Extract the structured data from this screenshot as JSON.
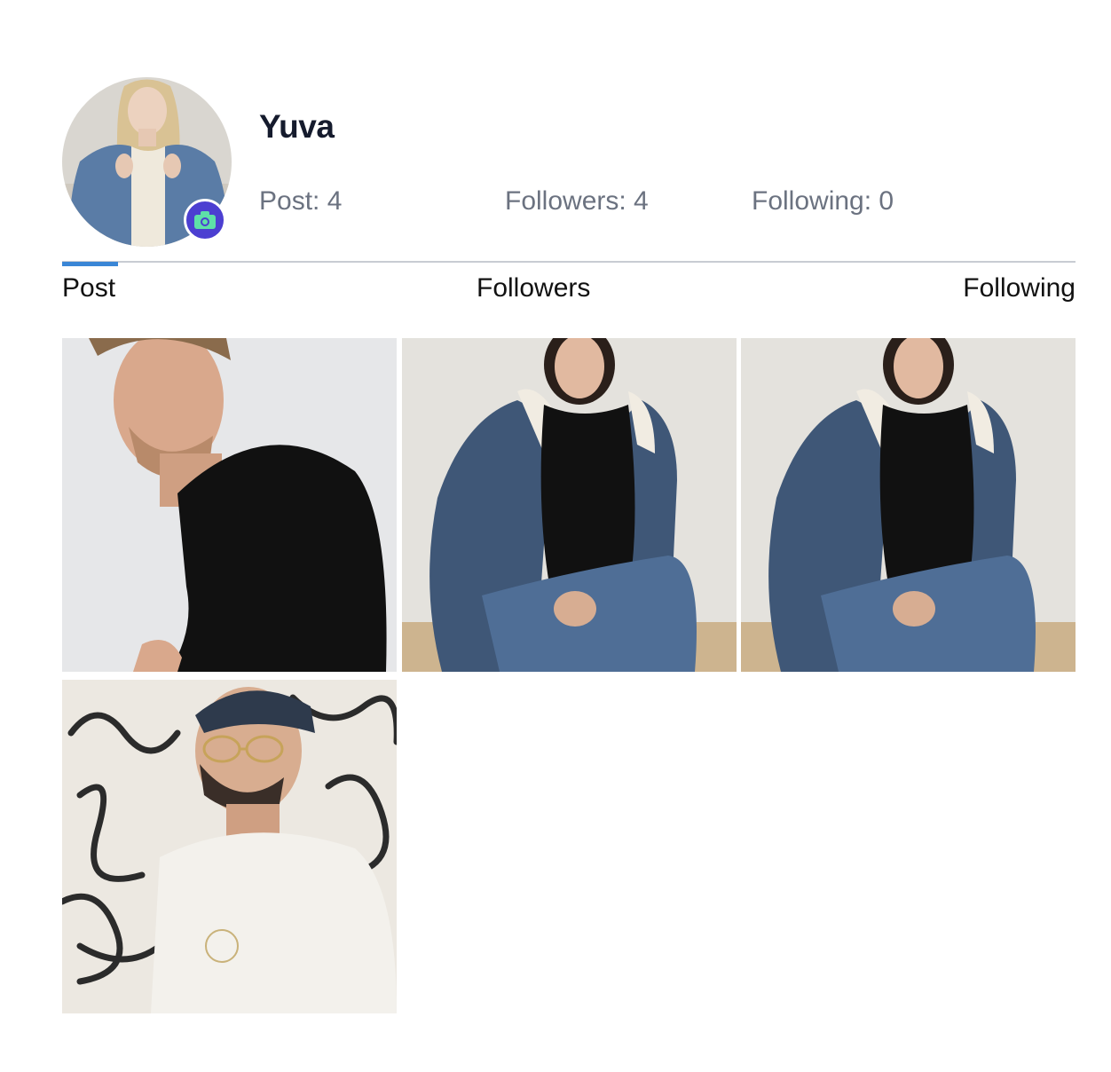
{
  "profile": {
    "username": "Yuva",
    "avatar_icon": "user-avatar-photo",
    "camera_icon": "camera-icon",
    "stats": {
      "posts": "Post: 4",
      "followers": "Followers: 4",
      "following": "Following: 0"
    }
  },
  "tabs": {
    "post": "Post",
    "followers": "Followers",
    "following": "Following",
    "active": "Post"
  },
  "posts": [
    {
      "alt": "post-photo"
    },
    {
      "alt": "post-photo"
    },
    {
      "alt": "post-photo"
    },
    {
      "alt": "post-photo"
    }
  ],
  "colors": {
    "accent": "#3a86d6",
    "badge": "#4c3fd1",
    "badge_icon": "#5ee0a8",
    "stat_text": "#6b7280"
  }
}
